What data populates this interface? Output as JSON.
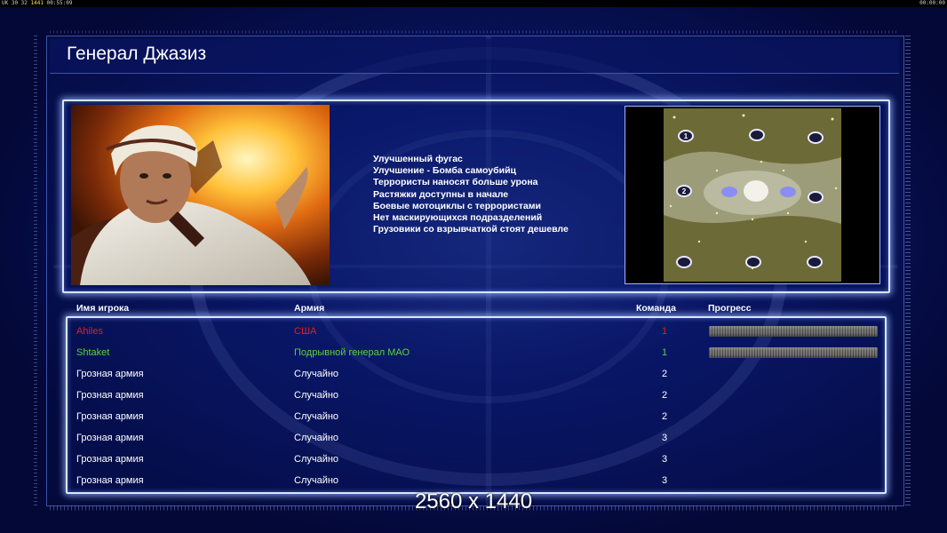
{
  "topbar": {
    "left_prefix": "UK 30 32 ",
    "left_highlight": "1441",
    "left_suffix": " 00:55:09",
    "right": "00:00:00"
  },
  "general": {
    "title": "Генерал Джазиз",
    "features": [
      "Улучшенный фугас",
      "Улучшение - Бомба самоубийц",
      "Террористы наносят больше урона",
      "Растяжки доступны в начале",
      "Боевые мотоциклы с террористами",
      "Нет маскирующихся подразделений",
      "Грузовики со взрывчаткой стоят дешевле"
    ]
  },
  "minimap": {
    "slot_labels": [
      "1",
      "2"
    ]
  },
  "table": {
    "headers": {
      "name": "Имя игрока",
      "army": "Армия",
      "team": "Команда",
      "progress": "Прогресс"
    },
    "rows": [
      {
        "name": "Ahiles",
        "army": "США",
        "team": "1",
        "color": "#e0201e",
        "progress": 1.0
      },
      {
        "name": "Shtaket",
        "army": "Подрывной генерал МАО",
        "team": "1",
        "color": "#58d33a",
        "progress": 1.0
      },
      {
        "name": "Грозная армия",
        "army": "Случайно",
        "team": "2",
        "color": "#ffffff"
      },
      {
        "name": "Грозная армия",
        "army": "Случайно",
        "team": "2",
        "color": "#ffffff"
      },
      {
        "name": "Грозная армия",
        "army": "Случайно",
        "team": "2",
        "color": "#ffffff"
      },
      {
        "name": "Грозная армия",
        "army": "Случайно",
        "team": "3",
        "color": "#ffffff"
      },
      {
        "name": "Грозная армия",
        "army": "Случайно",
        "team": "3",
        "color": "#ffffff"
      },
      {
        "name": "Грозная армия",
        "army": "Случайно",
        "team": "3",
        "color": "#ffffff"
      }
    ]
  },
  "overlay": {
    "resolution": "2560 x 1440"
  },
  "colors": {
    "panel_border": "#d8e6ff",
    "background": "#030a3a"
  }
}
